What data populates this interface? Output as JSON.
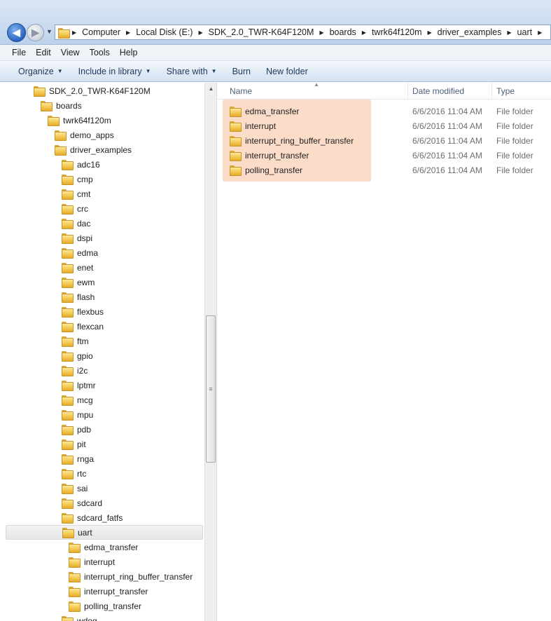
{
  "address": {
    "crumbs": [
      "Computer",
      "Local Disk (E:)",
      "SDK_2.0_TWR-K64F120M",
      "boards",
      "twrk64f120m",
      "driver_examples",
      "uart"
    ]
  },
  "menu": [
    "File",
    "Edit",
    "View",
    "Tools",
    "Help"
  ],
  "toolbar": {
    "organize": "Organize",
    "include_in_library": "Include in library",
    "share_with": "Share with",
    "burn": "Burn",
    "new_folder": "New folder"
  },
  "tree": [
    {
      "label": "SDK_2.0_TWR-K64F120M",
      "level": 0
    },
    {
      "label": "boards",
      "level": 1
    },
    {
      "label": "twrk64f120m",
      "level": 2
    },
    {
      "label": "demo_apps",
      "level": 3
    },
    {
      "label": "driver_examples",
      "level": 3
    },
    {
      "label": "adc16",
      "level": 4
    },
    {
      "label": "cmp",
      "level": 4
    },
    {
      "label": "cmt",
      "level": 4
    },
    {
      "label": "crc",
      "level": 4
    },
    {
      "label": "dac",
      "level": 4
    },
    {
      "label": "dspi",
      "level": 4
    },
    {
      "label": "edma",
      "level": 4
    },
    {
      "label": "enet",
      "level": 4
    },
    {
      "label": "ewm",
      "level": 4
    },
    {
      "label": "flash",
      "level": 4
    },
    {
      "label": "flexbus",
      "level": 4
    },
    {
      "label": "flexcan",
      "level": 4
    },
    {
      "label": "ftm",
      "level": 4
    },
    {
      "label": "gpio",
      "level": 4
    },
    {
      "label": "i2c",
      "level": 4
    },
    {
      "label": "lptmr",
      "level": 4
    },
    {
      "label": "mcg",
      "level": 4
    },
    {
      "label": "mpu",
      "level": 4
    },
    {
      "label": "pdb",
      "level": 4
    },
    {
      "label": "pit",
      "level": 4
    },
    {
      "label": "rnga",
      "level": 4
    },
    {
      "label": "rtc",
      "level": 4
    },
    {
      "label": "sai",
      "level": 4
    },
    {
      "label": "sdcard",
      "level": 4
    },
    {
      "label": "sdcard_fatfs",
      "level": 4
    },
    {
      "label": "uart",
      "level": 4,
      "selected": true
    },
    {
      "label": "edma_transfer",
      "level": 5
    },
    {
      "label": "interrupt",
      "level": 5
    },
    {
      "label": "interrupt_ring_buffer_transfer",
      "level": 5
    },
    {
      "label": "interrupt_transfer",
      "level": 5
    },
    {
      "label": "polling_transfer",
      "level": 5
    },
    {
      "label": "wdog",
      "level": 4
    }
  ],
  "columns": {
    "name": "Name",
    "date": "Date modified",
    "type": "Type"
  },
  "files": [
    {
      "name": "edma_transfer",
      "date": "6/6/2016 11:04 AM",
      "type": "File folder"
    },
    {
      "name": "interrupt",
      "date": "6/6/2016 11:04 AM",
      "type": "File folder"
    },
    {
      "name": "interrupt_ring_buffer_transfer",
      "date": "6/6/2016 11:04 AM",
      "type": "File folder"
    },
    {
      "name": "interrupt_transfer",
      "date": "6/6/2016 11:04 AM",
      "type": "File folder"
    },
    {
      "name": "polling_transfer",
      "date": "6/6/2016 11:04 AM",
      "type": "File folder"
    }
  ],
  "colors": {
    "highlight": "#fbdcc9",
    "selected_row": "#e6e6e6"
  }
}
